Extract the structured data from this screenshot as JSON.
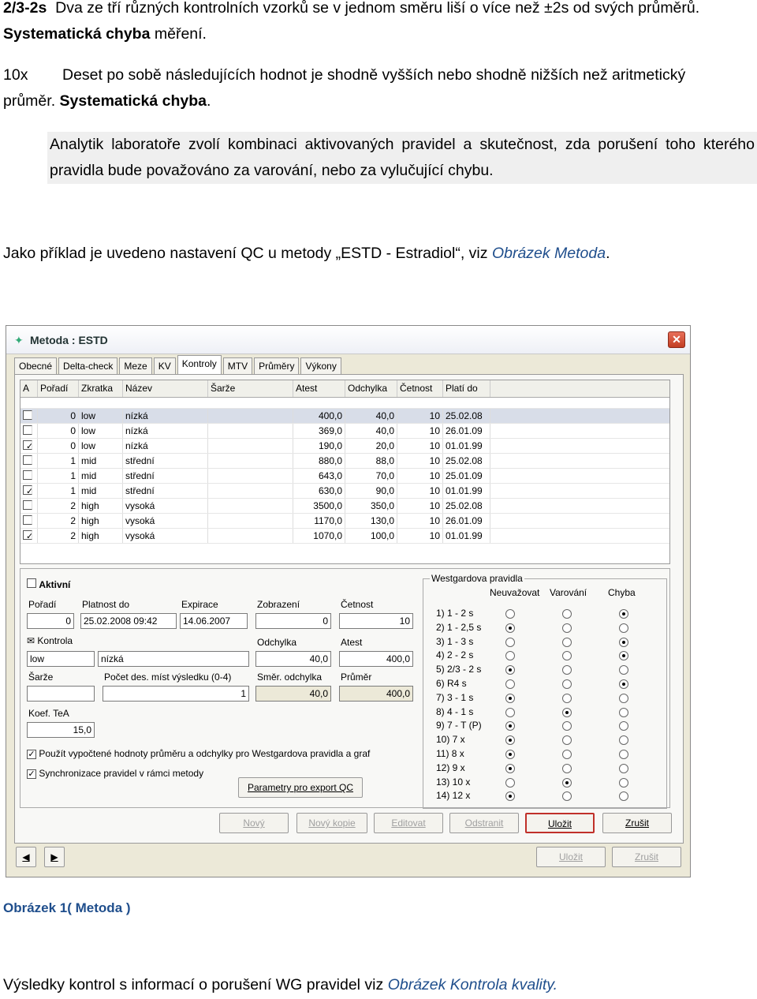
{
  "doc": {
    "l1_code": "2/3-2s",
    "l1_text": "Dva ze tří různých kontrolních vzorků se v jednom směru liší o více než ±2s od svých průměrů.",
    "l2_bold": "Systematická chyba",
    "l2_rest": " měření.",
    "l3_code": "10x",
    "l3_text": "Deset po sobě následujících hodnot je shodně vyšších nebo shodně nižších než aritmetický",
    "l4_start": "průměr. ",
    "l4_bold": "Systematická chyba",
    "l4_end": ".",
    "highlight": "Analytik laboratoře zvolí kombinaci aktivovaných pravidel a skutečnost, zda porušení toho kterého pravidla bude považováno za varování, nebo za vylučující chybu.",
    "example_pre": "Jako příklad je uvedeno nastavení QC u metody „ESTD - Estradiol“, viz ",
    "example_link": "Obrázek Metoda",
    "example_post": ".",
    "caption": "Obrázek 1( Metoda )",
    "results_pre": "Výsledky kontrol s informací o porušení WG pravidel viz ",
    "results_link": "Obrázek Kontrola kvality."
  },
  "dialog": {
    "title": "Metoda : ESTD",
    "close": "✕",
    "tabs": [
      "Obecné",
      "Delta-check",
      "Meze",
      "KV",
      "Kontroly",
      "MTV",
      "Průměry",
      "Výkony"
    ],
    "columns": [
      "A",
      "Pořadí",
      "Zkratka",
      "Název",
      "Šarže",
      "Atest",
      "Odchylka",
      "Četnost",
      "Platí do"
    ],
    "rows": [
      {
        "a": false,
        "poradi": "0",
        "zkratka": "low",
        "nazev": "nízká",
        "atest": "400,0",
        "odchylka": "40,0",
        "cetnost": "10",
        "plati": "25.02.08"
      },
      {
        "a": false,
        "poradi": "0",
        "zkratka": "low",
        "nazev": "nízká",
        "atest": "369,0",
        "odchylka": "40,0",
        "cetnost": "10",
        "plati": "26.01.09"
      },
      {
        "a": true,
        "poradi": "0",
        "zkratka": "low",
        "nazev": "nízká",
        "atest": "190,0",
        "odchylka": "20,0",
        "cetnost": "10",
        "plati": "01.01.99"
      },
      {
        "a": false,
        "poradi": "1",
        "zkratka": "mid",
        "nazev": "střední",
        "atest": "880,0",
        "odchylka": "88,0",
        "cetnost": "10",
        "plati": "25.02.08"
      },
      {
        "a": false,
        "poradi": "1",
        "zkratka": "mid",
        "nazev": "střední",
        "atest": "643,0",
        "odchylka": "70,0",
        "cetnost": "10",
        "plati": "25.01.09"
      },
      {
        "a": true,
        "poradi": "1",
        "zkratka": "mid",
        "nazev": "střední",
        "atest": "630,0",
        "odchylka": "90,0",
        "cetnost": "10",
        "plati": "01.01.99"
      },
      {
        "a": false,
        "poradi": "2",
        "zkratka": "high",
        "nazev": "vysoká",
        "atest": "3500,0",
        "odchylka": "350,0",
        "cetnost": "10",
        "plati": "25.02.08"
      },
      {
        "a": false,
        "poradi": "2",
        "zkratka": "high",
        "nazev": "vysoká",
        "atest": "1170,0",
        "odchylka": "130,0",
        "cetnost": "10",
        "plati": "26.01.09"
      },
      {
        "a": true,
        "poradi": "2",
        "zkratka": "high",
        "nazev": "vysoká",
        "atest": "1070,0",
        "odchylka": "100,0",
        "cetnost": "10",
        "plati": "01.01.99"
      }
    ],
    "form": {
      "aktivni": "Aktivní",
      "poradi_lbl": "Pořadí",
      "poradi": "0",
      "platnost_lbl": "Platnost do",
      "platnost": "25.02.2008 09:42",
      "expirace_lbl": "Expirace",
      "expirace": "14.06.2007",
      "zobrazeni_lbl": "Zobrazení",
      "zobrazeni": "0",
      "cetnost_lbl": "Četnost",
      "cetnost": "10",
      "kontrola_lbl": "Kontrola",
      "kontrola_zk": "low",
      "kontrola_naz": "nízká",
      "odchylka_lbl": "Odchylka",
      "odchylka": "40,0",
      "atest_lbl": "Atest",
      "atest": "400,0",
      "sarze_lbl": "Šarže",
      "sarze": "",
      "pocet_lbl": "Počet des. míst výsledku (0-4)",
      "pocet": "1",
      "smer_lbl": "Směr. odchylka",
      "smer": "40,0",
      "prumer_lbl": "Průměr",
      "prumer": "400,0",
      "koef_lbl": "Koef. TeA",
      "koef": "15,0",
      "chk1": "Použít vypočtené hodnoty průměru a odchylky pro Westgardova pravidla a graf",
      "chk2": "Synchronizace pravidel v rámci metody",
      "export_btn": "Parametry pro export QC"
    },
    "westgard": {
      "title": "Westgardova pravidla",
      "col1": "Neuvažovat",
      "col2": "Varování",
      "col3": "Chyba",
      "rules": [
        {
          "name": "1)  1 - 2 s",
          "sel": 3
        },
        {
          "name": "2)  1 - 2,5 s",
          "sel": 1
        },
        {
          "name": "3)  1 - 3 s",
          "sel": 3
        },
        {
          "name": "4)  2 - 2 s",
          "sel": 3
        },
        {
          "name": "5)  2/3 - 2 s",
          "sel": 1
        },
        {
          "name": "6)  R4 s",
          "sel": 3
        },
        {
          "name": "7)  3 - 1 s",
          "sel": 1
        },
        {
          "name": "8)  4 - 1 s",
          "sel": 2
        },
        {
          "name": "9)  7 - T (P)",
          "sel": 1
        },
        {
          "name": "10)  7 x",
          "sel": 1
        },
        {
          "name": "11)  8 x",
          "sel": 1
        },
        {
          "name": "12)  9 x",
          "sel": 1
        },
        {
          "name": "13)  10 x",
          "sel": 2
        },
        {
          "name": "14)  12 x",
          "sel": 1
        }
      ]
    },
    "buttons": {
      "novy": "Nový",
      "kopie": "Nový kopie",
      "edit": "Editovat",
      "odstranit": "Odstranit",
      "ulozit": "Uložit",
      "zrusit": "Zrušit",
      "ulozit2": "Uložit",
      "zrusit2": "Zrušit"
    },
    "nav": {
      "prev": "◀",
      "next": "▶"
    }
  }
}
